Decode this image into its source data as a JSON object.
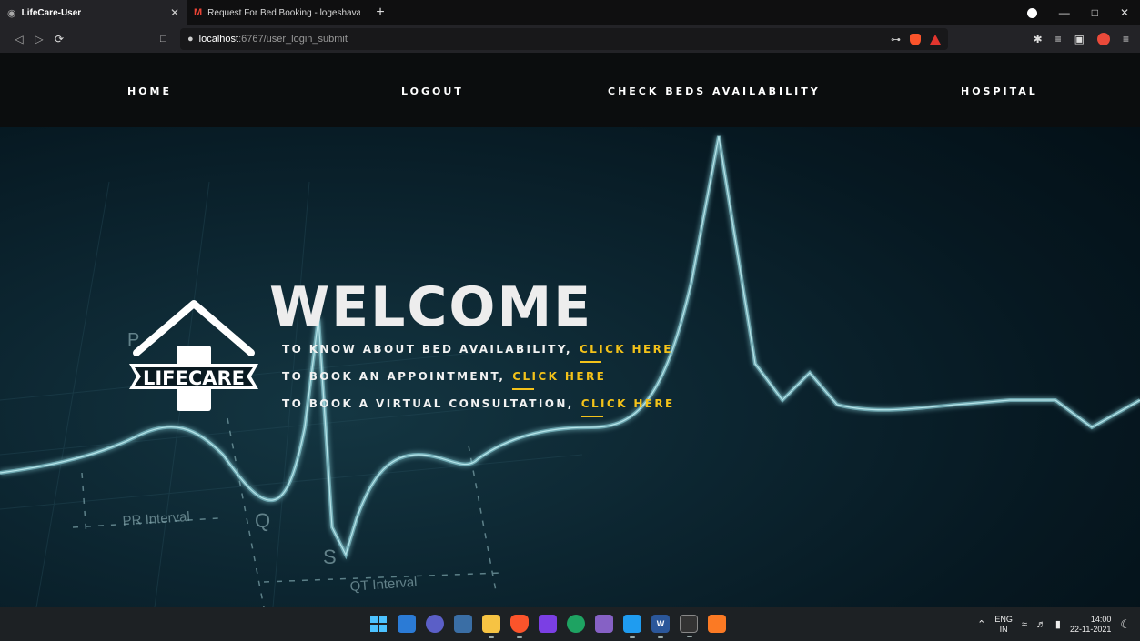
{
  "browser": {
    "tabs": [
      {
        "title": "LifeCare-User",
        "icon": "globe-icon",
        "active": true
      },
      {
        "title": "Request For Bed Booking - logeshavar",
        "icon": "gmail-icon",
        "active": false
      }
    ],
    "new_tab": "+",
    "url_host": "localhost",
    "url_path": ":6767/user_login_submit"
  },
  "navbar": {
    "items": [
      "HOME",
      "LOGOUT",
      "CHECK BEDS AVAILABILITY",
      "HOSPITAL"
    ]
  },
  "logo": {
    "text": "LIFECARE"
  },
  "hero": {
    "title": "WELCOME",
    "lines": [
      {
        "text": "TO KNOW ABOUT BED AVAILABILITY,",
        "cta": "CLICK HERE"
      },
      {
        "text": "TO BOOK AN APPOINTMENT,",
        "cta": "CLICK HERE"
      },
      {
        "text": "TO BOOK A VIRTUAL CONSULTATION,",
        "cta": "CLICK HERE"
      }
    ]
  },
  "background_labels": {
    "p": "P",
    "q": "Q",
    "s": "S",
    "pr_interval": "PR Interval",
    "qt_interval": "QT Interval"
  },
  "colors": {
    "accent": "#f3c21a",
    "navbar_bg": "#0b0d0e",
    "page_bg": "#061821"
  },
  "taskbar": {
    "lang_top": "ENG",
    "lang_bottom": "IN",
    "time": "14:00",
    "date": "22-11-2021"
  }
}
